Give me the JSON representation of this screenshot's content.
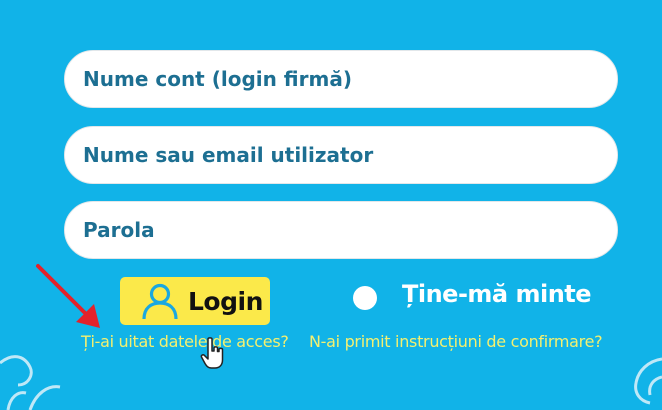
{
  "form": {
    "account_placeholder": "Nume cont (login firmă)",
    "user_placeholder": "Nume sau email utilizator",
    "password_placeholder": "Parola",
    "login_label": "Login",
    "remember_label": "Ține-mă minte",
    "forgot_link": "Ți-ai uitat datele de acces?",
    "confirm_link": "N-ai primit instrucțiuni de confirmare?"
  },
  "icons": {
    "login": "user-icon",
    "pointer": "hand-pointer-icon",
    "annotation": "red-arrow-icon"
  },
  "colors": {
    "background": "#11b3e8",
    "field_text": "#1d6f92",
    "login_button": "#fbe94a",
    "link_text": "#f4f070",
    "arrow": "#e3222b"
  }
}
